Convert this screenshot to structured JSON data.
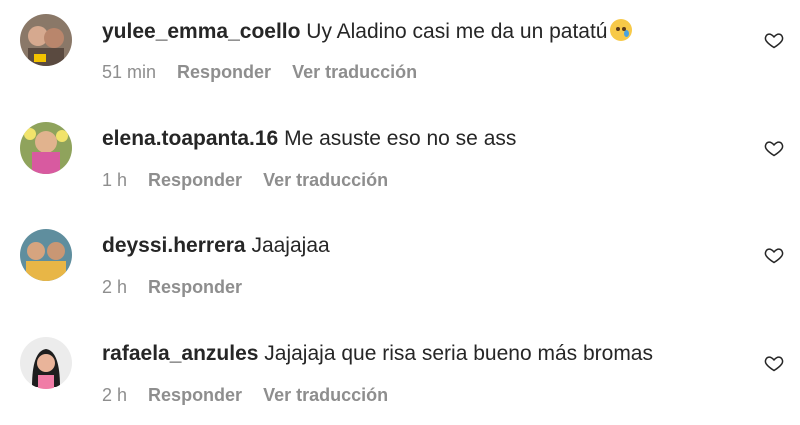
{
  "comments": [
    {
      "username": "yulee_emma_coello",
      "text": "Uy Aladino casi me da un patatú",
      "emoji": "crying-face",
      "time": "51 min",
      "reply_label": "Responder",
      "translate_label": "Ver traducción"
    },
    {
      "username": "elena.toapanta.16",
      "text": "Me asuste eso no se ass",
      "time": "1 h",
      "reply_label": "Responder",
      "translate_label": "Ver traducción"
    },
    {
      "username": "deyssi.herrera",
      "text": "Jaajajaa",
      "time": "2 h",
      "reply_label": "Responder"
    },
    {
      "username": "rafaela_anzules",
      "text": "Jajajaja que risa seria bueno más bromas",
      "time": "2 h",
      "reply_label": "Responder",
      "translate_label": "Ver traducción"
    }
  ],
  "colors": {
    "primary_text": "#262626",
    "secondary_text": "#8e8e8e"
  },
  "icons": {
    "like": "heart-outline-icon"
  }
}
